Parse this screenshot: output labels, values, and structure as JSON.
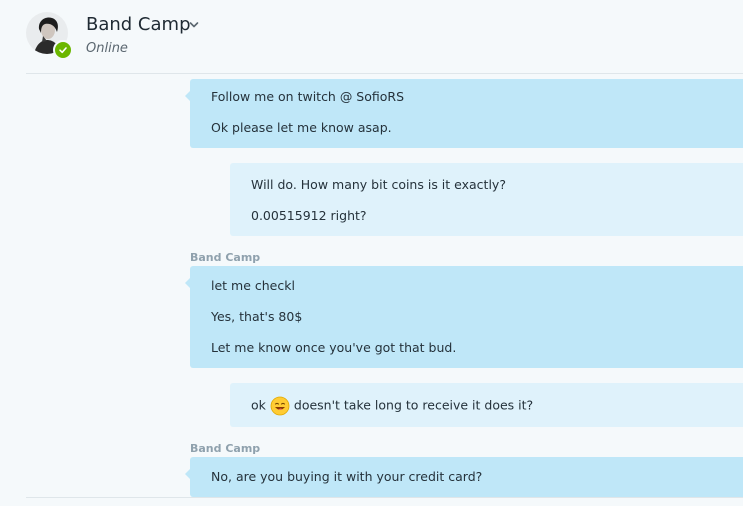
{
  "header": {
    "title": "Band Camp",
    "status": "Online"
  },
  "messages": [
    {
      "direction": "incoming",
      "lines": [
        "Follow me on twitch @ SofioRS",
        "Ok please let me know asap."
      ]
    },
    {
      "direction": "outgoing",
      "lines": [
        "Will do. How many bit coins is it exactly?",
        "0.00515912 right?"
      ]
    },
    {
      "direction": "incoming",
      "sender": "Band Camp",
      "lines": [
        "let me checkl",
        "Yes, that's 80$",
        "Let me know once you've got that bud."
      ]
    },
    {
      "direction": "outgoing",
      "prefix": "ok",
      "emoji": "grinning-face-emoji",
      "suffix": "doesn't take long to receive it does it?"
    },
    {
      "direction": "incoming",
      "sender": "Band Camp",
      "lines": [
        "No, are you buying it with your credit card?"
      ]
    }
  ],
  "colors": {
    "background": "#f5f9fb",
    "incoming_bubble": "#bfe7f8",
    "outgoing_bubble": "#dff2fb",
    "presence": "#6bb700",
    "sender_label": "#8fa1ad"
  }
}
